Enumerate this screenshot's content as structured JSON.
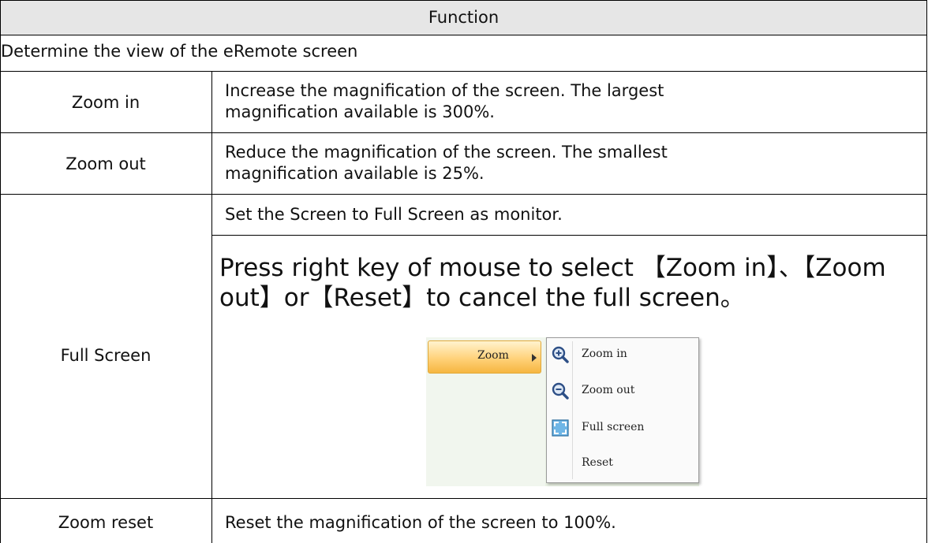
{
  "table": {
    "header": "Function",
    "subheader": "Determine the view of the eRemote screen",
    "rows": [
      {
        "name": "Zoom in",
        "description": [
          "Increase the magnification of the screen. The largest",
          "magnification available is 300%."
        ]
      },
      {
        "name": "Zoom out",
        "description": [
          "Reduce the magnification of the screen. The smallest",
          "magnification available is 25%."
        ]
      },
      {
        "name": "Full Screen",
        "description": "Set the Screen to Full Screen as monitor.",
        "note": [
          "Press right key of mouse to select 【Zoom in】、【Zoom",
          "out】or【Reset】to cancel the full screen。"
        ]
      },
      {
        "name": "Zoom reset",
        "description": "Reset the magnification of the screen to 100%."
      }
    ]
  },
  "context_menu": {
    "parent_item": "Zoom",
    "items": [
      {
        "label": "Zoom in",
        "icon": "zoom-in-icon"
      },
      {
        "label": "Zoom out",
        "icon": "zoom-out-icon"
      },
      {
        "label": "Full screen",
        "icon": "full-screen-icon"
      },
      {
        "label": "Reset",
        "icon": ""
      }
    ]
  },
  "colors": {
    "header_bg": "#e6e6e6",
    "highlight": "#ffd27a",
    "border": "#000000"
  }
}
